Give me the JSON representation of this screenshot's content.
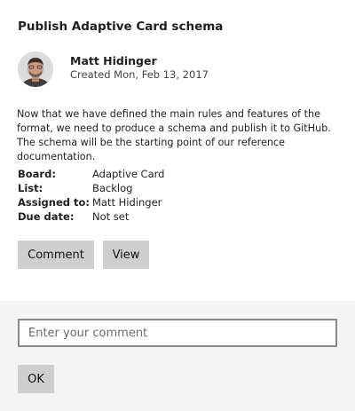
{
  "card": {
    "title": "Publish Adaptive Card schema",
    "author": {
      "name": "Matt Hidinger",
      "created": "Created Mon, Feb 13, 2017",
      "avatar_icon": "profile-photo"
    },
    "description": "Now that we have defined the main rules and features of the format, we need to produce a schema and publish it to GitHub. The schema will be the starting point of our reference documentation.",
    "facts": [
      {
        "key": "Board:",
        "value": "Adaptive Card"
      },
      {
        "key": "List:",
        "value": "Backlog"
      },
      {
        "key": "Assigned to:",
        "value": "Matt Hidinger"
      },
      {
        "key": "Due date:",
        "value": "Not set"
      }
    ],
    "actions": {
      "comment_label": "Comment",
      "view_label": "View"
    }
  },
  "comment_section": {
    "input": {
      "value": "",
      "placeholder": "Enter your comment"
    },
    "ok_label": "OK"
  },
  "colors": {
    "button_bg": "#cfcfcf",
    "panel_bg": "#f4f4f4",
    "input_border": "#8a8a8a"
  }
}
